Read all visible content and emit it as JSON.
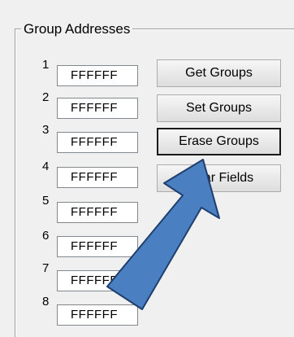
{
  "group": {
    "title": "Group Addresses",
    "rows": [
      {
        "label": "1",
        "value": "FFFFFF"
      },
      {
        "label": "2",
        "value": "FFFFFF"
      },
      {
        "label": "3",
        "value": "FFFFFF"
      },
      {
        "label": "4",
        "value": "FFFFFF"
      },
      {
        "label": "5",
        "value": "FFFFFF"
      },
      {
        "label": "6",
        "value": "FFFFFF"
      },
      {
        "label": "7",
        "value": "FFFFFF"
      },
      {
        "label": "8",
        "value": "FFFFFF"
      }
    ]
  },
  "buttons": {
    "get_groups": "Get Groups",
    "set_groups": "Set Groups",
    "erase_groups": "Erase Groups",
    "clear_fields": "Clear Fields"
  },
  "annotation": {
    "arrow_color": "#4a7fc1",
    "arrow_stroke": "#1f3f6e",
    "arrow_target": "erase-groups-button"
  }
}
